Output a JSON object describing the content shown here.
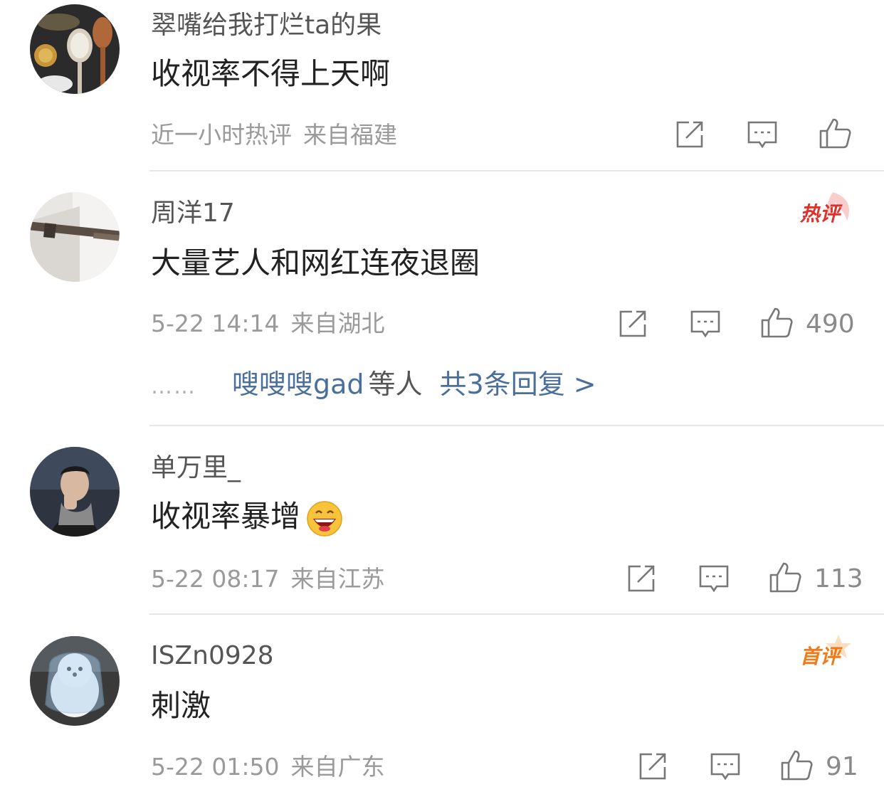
{
  "comments": [
    {
      "username": "翠嘴给我打烂ta的果",
      "content": "收视率不得上天啊",
      "time": "近一小时热评",
      "location": "来自福建",
      "likes": "",
      "badge": "",
      "avatar_icon": "spoons-avatar"
    },
    {
      "username": "周洋17",
      "content": "大量艺人和网红连夜退圈",
      "time": "5-22 14:14",
      "location": "来自湖北",
      "likes": "490",
      "badge": "热评",
      "avatar_icon": "rod-avatar",
      "replies": {
        "dots": "……",
        "who": "嗖嗖嗖gad",
        "rest": "等人",
        "total": "共3条回复 >"
      }
    },
    {
      "username": "单万里_",
      "content": "收视率暴增",
      "time": "5-22 08:17",
      "location": "来自江苏",
      "likes": "113",
      "badge": "",
      "avatar_icon": "man-avatar",
      "emoji": "laughing-emoji"
    },
    {
      "username": "ISZn0928",
      "content": "刺激",
      "time": "5-22 01:50",
      "location": "来自广东",
      "likes": "91",
      "badge": "首评",
      "avatar_icon": "dog-avatar"
    }
  ],
  "colors": {
    "hot_badge": "#e0302a",
    "first_badge": "#f07a1a",
    "link": "#4a6f9a",
    "meta": "#9a9a9a"
  },
  "icons": {
    "share": "share-icon",
    "comment": "comment-icon",
    "like": "thumbs-up-icon"
  }
}
